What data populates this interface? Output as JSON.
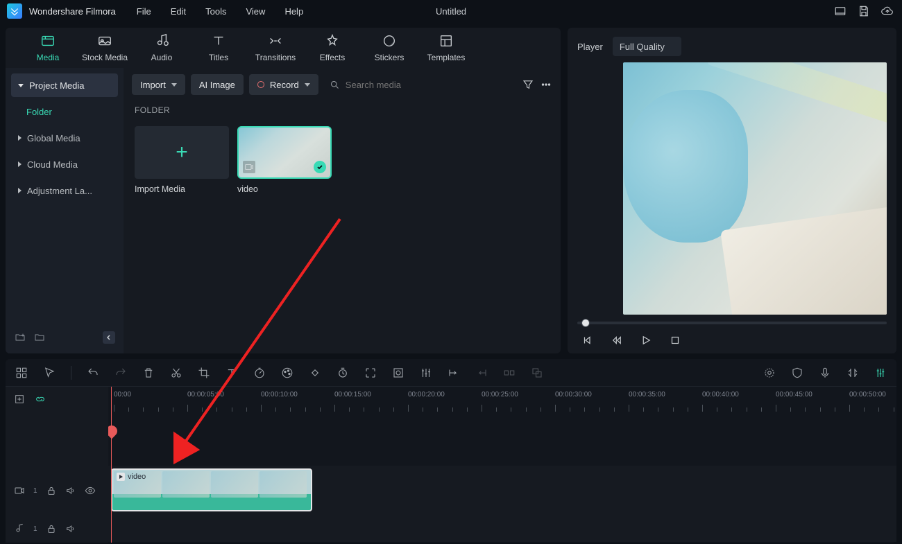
{
  "app": {
    "title": "Wondershare Filmora",
    "document": "Untitled"
  },
  "menu": [
    "File",
    "Edit",
    "Tools",
    "View",
    "Help"
  ],
  "tabs": [
    {
      "label": "Media",
      "active": true
    },
    {
      "label": "Stock Media"
    },
    {
      "label": "Audio"
    },
    {
      "label": "Titles"
    },
    {
      "label": "Transitions"
    },
    {
      "label": "Effects"
    },
    {
      "label": "Stickers"
    },
    {
      "label": "Templates"
    }
  ],
  "sidebar": {
    "items": [
      {
        "label": "Project Media",
        "selected": true
      },
      {
        "label": "Folder",
        "child": true
      },
      {
        "label": "Global Media"
      },
      {
        "label": "Cloud Media"
      },
      {
        "label": "Adjustment La..."
      }
    ]
  },
  "toolbar": {
    "import": "Import",
    "ai_image": "AI Image",
    "record": "Record",
    "search_placeholder": "Search media"
  },
  "content": {
    "folder_label": "FOLDER",
    "thumbs": [
      {
        "label": "Import Media",
        "type": "import"
      },
      {
        "label": "video",
        "type": "video"
      }
    ]
  },
  "player": {
    "label": "Player",
    "quality": "Full Quality"
  },
  "timeline": {
    "ticks": [
      "00:00",
      "00:00:05:00",
      "00:00:10:00",
      "00:00:15:00",
      "00:00:20:00",
      "00:00:25:00",
      "00:00:30:00",
      "00:00:35:00",
      "00:00:40:00",
      "00:00:45:00",
      "00:00:50:00"
    ],
    "clip_label": "video",
    "video_track_index": "1",
    "audio_track_index": "1"
  }
}
